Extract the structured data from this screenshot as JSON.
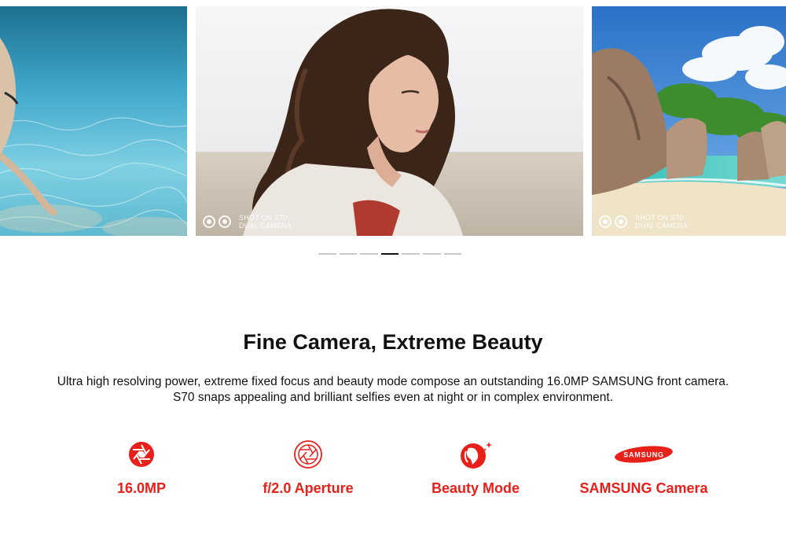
{
  "carousel": {
    "slides": [
      {
        "name": "underwater-photo",
        "watermark": null
      },
      {
        "name": "portrait-photo",
        "watermark": {
          "line1": "SHOT ON S70",
          "line2": "DUAL CAMERA"
        }
      },
      {
        "name": "beach-photo",
        "watermark": {
          "line1": "SHOT ON S70",
          "line2": "DUAL CAMERA"
        }
      }
    ],
    "dot_count": 7,
    "active_dot": 4
  },
  "section": {
    "title": "Fine Camera, Extreme Beauty",
    "description_line1": "Ultra high resolving power, extreme fixed focus and beauty mode compose an outstanding 16.0MP SAMSUNG front camera.",
    "description_line2": "S70 snaps appealing and brilliant selfies even at night or in complex environment."
  },
  "features": [
    {
      "icon": "aperture-icon",
      "label": "16.0MP"
    },
    {
      "icon": "aperture-outline-icon",
      "label": "f/2.0 Aperture"
    },
    {
      "icon": "beauty-face-icon",
      "label": "Beauty Mode"
    },
    {
      "icon": "samsung-logo-icon",
      "label": "SAMSUNG Camera",
      "logo_text": "SAMSUNG"
    }
  ],
  "colors": {
    "accent": "#e8201a",
    "text": "#111111",
    "dot_inactive": "#c8c8c8",
    "dot_active": "#111111"
  }
}
